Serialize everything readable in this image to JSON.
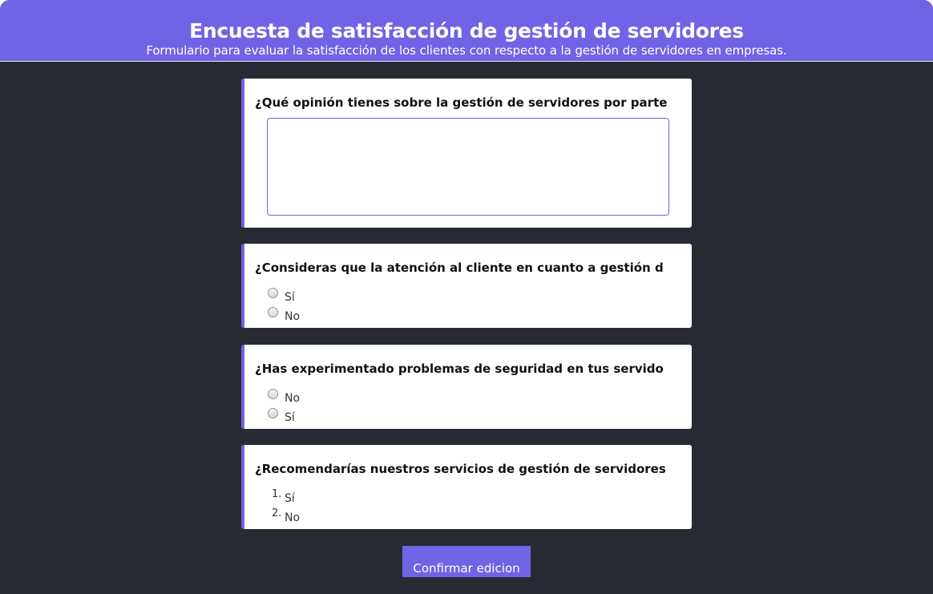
{
  "header": {
    "title": "Encuesta de satisfacción de gestión de servidores",
    "subtitle": "Formulario para evaluar la satisfacción de los clientes con respecto a la gestión de servidores en empresas."
  },
  "questions": [
    {
      "text": "¿Qué opinión tienes sobre la gestión de servidores por parte",
      "answer_value": ""
    },
    {
      "text": "¿Consideras que la atención al cliente en cuanto a gestión d",
      "options": [
        "Sí",
        "No"
      ]
    },
    {
      "text": "¿Has experimentado problemas de seguridad en tus servido",
      "options": [
        "No",
        "Sí"
      ]
    },
    {
      "text": "¿Recomendarías nuestros servicios de gestión de servidores",
      "options": [
        {
          "marker": "1.",
          "label": "Sí"
        },
        {
          "marker": "2.",
          "label": "No"
        }
      ]
    }
  ],
  "confirm_button": "Confirmar edicion",
  "colors": {
    "accent": "#7163e5",
    "background": "#282a33",
    "card": "#ffffff"
  }
}
